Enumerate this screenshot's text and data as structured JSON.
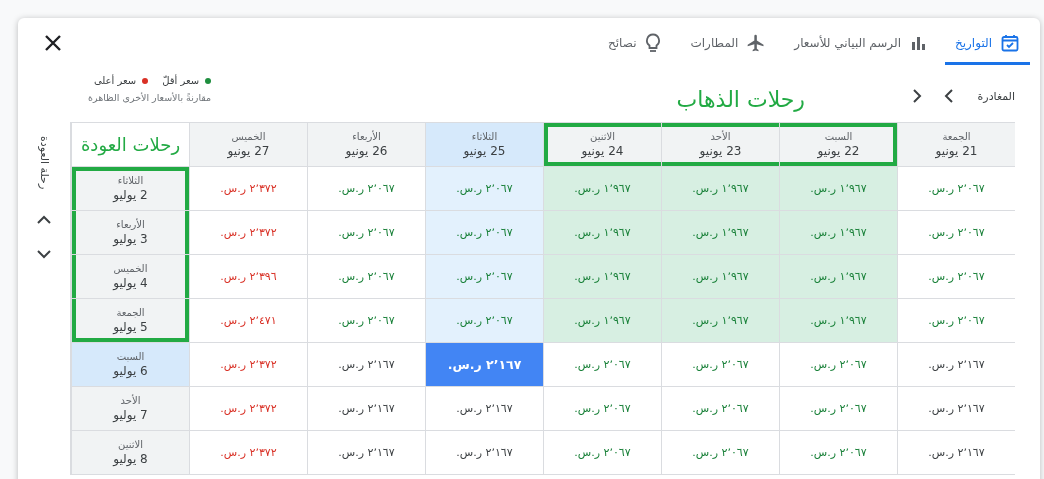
{
  "tabs": [
    {
      "label": "التواريخ",
      "kind": "calendar",
      "selected": true
    },
    {
      "label": "الرسم البياني للأسعار",
      "kind": "chart",
      "selected": false
    },
    {
      "label": "المطارات",
      "kind": "plane",
      "selected": false
    },
    {
      "label": "نصائح",
      "kind": "bulb",
      "selected": false
    }
  ],
  "legend": {
    "items": [
      {
        "label": "سعر أقلّ",
        "color": "#1e8e3e"
      },
      {
        "label": "سعر أعلى",
        "color": "#d93025"
      }
    ],
    "note": "مقارنةً بالأسعار الأخرى الظاهرة"
  },
  "departure": {
    "label": "المغادرة"
  },
  "return_axis": {
    "label": "رحلة العودة"
  },
  "annotations": {
    "departures": "رحلات الذهاب",
    "returns": "رحلات العودة"
  },
  "columns": [
    {
      "day": "الجمعة",
      "date": "21 يونيو",
      "selected": false,
      "outlined": false
    },
    {
      "day": "السبت",
      "date": "22 يونيو",
      "selected": false,
      "outlined": true
    },
    {
      "day": "الأحد",
      "date": "23 يونيو",
      "selected": false,
      "outlined": true
    },
    {
      "day": "الاثنين",
      "date": "24 يونيو",
      "selected": false,
      "outlined": true
    },
    {
      "day": "الثلاثاء",
      "date": "25 يونيو",
      "selected": true,
      "outlined": false
    },
    {
      "day": "الأربعاء",
      "date": "26 يونيو",
      "selected": false,
      "outlined": false
    },
    {
      "day": "الخميس",
      "date": "27 يونيو",
      "selected": false,
      "outlined": false
    }
  ],
  "rows": [
    {
      "day": "الثلاثاء",
      "date": "2 يوليو",
      "selected": false,
      "outlined": true,
      "cells": [
        {
          "price": "٢٬٠٦٧ ر.س.",
          "color": "#188038",
          "cheapest": false,
          "selected": false
        },
        {
          "price": "١٬٩٦٧ ر.س.",
          "color": "#188038",
          "cheapest": true,
          "selected": false
        },
        {
          "price": "١٬٩٦٧ ر.س.",
          "color": "#188038",
          "cheapest": true,
          "selected": false
        },
        {
          "price": "١٬٩٦٧ ر.س.",
          "color": "#188038",
          "cheapest": true,
          "selected": false
        },
        {
          "price": "٢٬٠٦٧ ر.س.",
          "color": "#188038",
          "cheapest": false,
          "selected": false
        },
        {
          "price": "٢٬٠٦٧ ر.س.",
          "color": "#188038",
          "cheapest": false,
          "selected": false
        },
        {
          "price": "٢٬٣٧٢ ر.س.",
          "color": "#d93025",
          "cheapest": false,
          "selected": false
        }
      ]
    },
    {
      "day": "الأربعاء",
      "date": "3 يوليو",
      "selected": false,
      "outlined": true,
      "cells": [
        {
          "price": "٢٬٠٦٧ ر.س.",
          "color": "#188038",
          "cheapest": false,
          "selected": false
        },
        {
          "price": "١٬٩٦٧ ر.س.",
          "color": "#188038",
          "cheapest": true,
          "selected": false
        },
        {
          "price": "١٬٩٦٧ ر.س.",
          "color": "#188038",
          "cheapest": true,
          "selected": false
        },
        {
          "price": "١٬٩٦٧ ر.س.",
          "color": "#188038",
          "cheapest": true,
          "selected": false
        },
        {
          "price": "٢٬٠٦٧ ر.س.",
          "color": "#188038",
          "cheapest": false,
          "selected": false
        },
        {
          "price": "٢٬٠٦٧ ر.س.",
          "color": "#188038",
          "cheapest": false,
          "selected": false
        },
        {
          "price": "٢٬٣٧٢ ر.س.",
          "color": "#d93025",
          "cheapest": false,
          "selected": false
        }
      ]
    },
    {
      "day": "الخميس",
      "date": "4 يوليو",
      "selected": false,
      "outlined": true,
      "cells": [
        {
          "price": "٢٬٠٦٧ ر.س.",
          "color": "#188038",
          "cheapest": false,
          "selected": false
        },
        {
          "price": "١٬٩٦٧ ر.س.",
          "color": "#188038",
          "cheapest": true,
          "selected": false
        },
        {
          "price": "١٬٩٦٧ ر.س.",
          "color": "#188038",
          "cheapest": true,
          "selected": false
        },
        {
          "price": "١٬٩٦٧ ر.س.",
          "color": "#188038",
          "cheapest": true,
          "selected": false
        },
        {
          "price": "٢٬٠٦٧ ر.س.",
          "color": "#188038",
          "cheapest": false,
          "selected": false
        },
        {
          "price": "٢٬٠٦٧ ر.س.",
          "color": "#188038",
          "cheapest": false,
          "selected": false
        },
        {
          "price": "٢٬٣٩٦ ر.س.",
          "color": "#d93025",
          "cheapest": false,
          "selected": false
        }
      ]
    },
    {
      "day": "الجمعة",
      "date": "5 يوليو",
      "selected": false,
      "outlined": true,
      "cells": [
        {
          "price": "٢٬٠٦٧ ر.س.",
          "color": "#188038",
          "cheapest": false,
          "selected": false
        },
        {
          "price": "١٬٩٦٧ ر.س.",
          "color": "#188038",
          "cheapest": true,
          "selected": false
        },
        {
          "price": "١٬٩٦٧ ر.س.",
          "color": "#188038",
          "cheapest": true,
          "selected": false
        },
        {
          "price": "١٬٩٦٧ ر.س.",
          "color": "#188038",
          "cheapest": true,
          "selected": false
        },
        {
          "price": "٢٬٠٦٧ ر.س.",
          "color": "#188038",
          "cheapest": false,
          "selected": false
        },
        {
          "price": "٢٬٠٦٧ ر.س.",
          "color": "#188038",
          "cheapest": false,
          "selected": false
        },
        {
          "price": "٢٬٤٧١ ر.س.",
          "color": "#d93025",
          "cheapest": false,
          "selected": false
        }
      ]
    },
    {
      "day": "السبت",
      "date": "6 يوليو",
      "selected": true,
      "outlined": false,
      "cells": [
        {
          "price": "٢٬١٦٧ ر.س.",
          "color": "#3c4043",
          "cheapest": false,
          "selected": false
        },
        {
          "price": "٢٬٠٦٧ ر.س.",
          "color": "#188038",
          "cheapest": false,
          "selected": false
        },
        {
          "price": "٢٬٠٦٧ ر.س.",
          "color": "#188038",
          "cheapest": false,
          "selected": false
        },
        {
          "price": "٢٬٠٦٧ ر.س.",
          "color": "#188038",
          "cheapest": false,
          "selected": false
        },
        {
          "price": "٢٬١٦٧ ر.س.",
          "cheapest": false,
          "selected": true
        },
        {
          "price": "٢٬١٦٧ ر.س.",
          "color": "#3c4043",
          "cheapest": false,
          "selected": false
        },
        {
          "price": "٢٬٣٧٢ ر.س.",
          "color": "#d93025",
          "cheapest": false,
          "selected": false
        }
      ]
    },
    {
      "day": "الأحد",
      "date": "7 يوليو",
      "selected": false,
      "outlined": false,
      "cells": [
        {
          "price": "٢٬١٦٧ ر.س.",
          "color": "#3c4043",
          "cheapest": false,
          "selected": false
        },
        {
          "price": "٢٬٠٦٧ ر.س.",
          "color": "#188038",
          "cheapest": false,
          "selected": false
        },
        {
          "price": "٢٬٠٦٧ ر.س.",
          "color": "#188038",
          "cheapest": false,
          "selected": false
        },
        {
          "price": "٢٬٠٦٧ ر.س.",
          "color": "#188038",
          "cheapest": false,
          "selected": false
        },
        {
          "price": "٢٬١٦٧ ر.س.",
          "color": "#3c4043",
          "cheapest": false,
          "selected": false
        },
        {
          "price": "٢٬١٦٧ ر.س.",
          "color": "#3c4043",
          "cheapest": false,
          "selected": false
        },
        {
          "price": "٢٬٣٧٢ ر.س.",
          "color": "#d93025",
          "cheapest": false,
          "selected": false
        }
      ]
    },
    {
      "day": "الاثنين",
      "date": "8 يوليو",
      "selected": false,
      "outlined": false,
      "cells": [
        {
          "price": "٢٬١٦٧ ر.س.",
          "color": "#3c4043",
          "cheapest": false,
          "selected": false
        },
        {
          "price": "٢٬٠٦٧ ر.س.",
          "color": "#188038",
          "cheapest": false,
          "selected": false
        },
        {
          "price": "٢٬٠٦٧ ر.س.",
          "color": "#188038",
          "cheapest": false,
          "selected": false
        },
        {
          "price": "٢٬٠٦٧ ر.س.",
          "color": "#188038",
          "cheapest": false,
          "selected": false
        },
        {
          "price": "٢٬١٦٧ ر.س.",
          "color": "#3c4043",
          "cheapest": false,
          "selected": false
        },
        {
          "price": "٢٬١٦٧ ر.س.",
          "color": "#3c4043",
          "cheapest": false,
          "selected": false
        },
        {
          "price": "٢٬٣٧٢ ر.س.",
          "color": "#d93025",
          "cheapest": false,
          "selected": false
        }
      ]
    }
  ]
}
